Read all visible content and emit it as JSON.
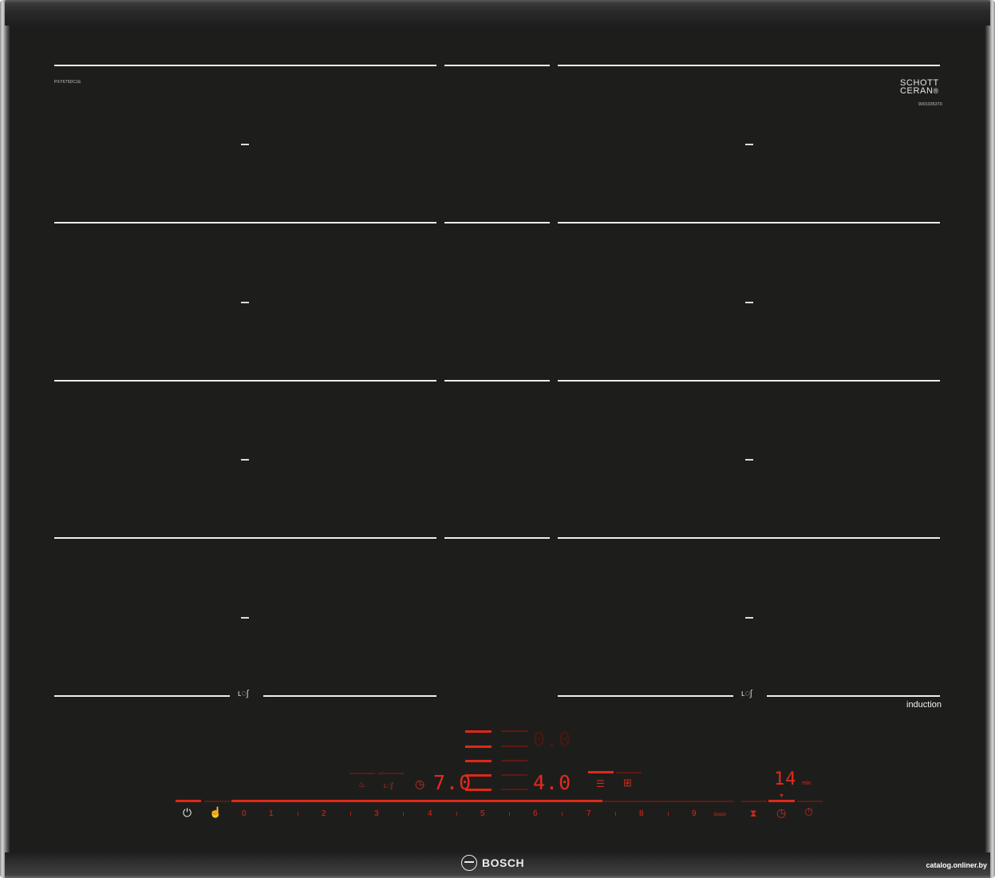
{
  "hob": {
    "model": "PXY675DC1E",
    "schott_line1": "SCHOTT",
    "schott_line2": "CERAN",
    "schott_mark": "®",
    "serial": "9001035370",
    "induction_label": "induction",
    "brand": "BOSCH",
    "watermark": "catalog.onliner.by",
    "accent_color": "#e12b1c"
  },
  "display": {
    "left_value": "7.0",
    "center_value": "4.0",
    "top_value": "0.0",
    "timer_value": "14",
    "timer_unit": "min"
  },
  "power_scale": [
    "0",
    "1",
    "2",
    "3",
    "4",
    "5",
    "6",
    "7",
    "8",
    "9"
  ],
  "boost_label": "boost",
  "icons": {
    "power": "power-icon",
    "child_lock": "child-lock-icon",
    "hourglass": "hourglass-icon",
    "timer": "timer-icon",
    "stopwatch": "stopwatch-icon",
    "pot": "pot-icon",
    "pan": "pan-sensor-icon",
    "clock": "clock-icon",
    "flex_zone": "flex-zone-icon",
    "move_zone": "move-zone-icon",
    "frying_sensor": "frying-sensor-icon"
  }
}
